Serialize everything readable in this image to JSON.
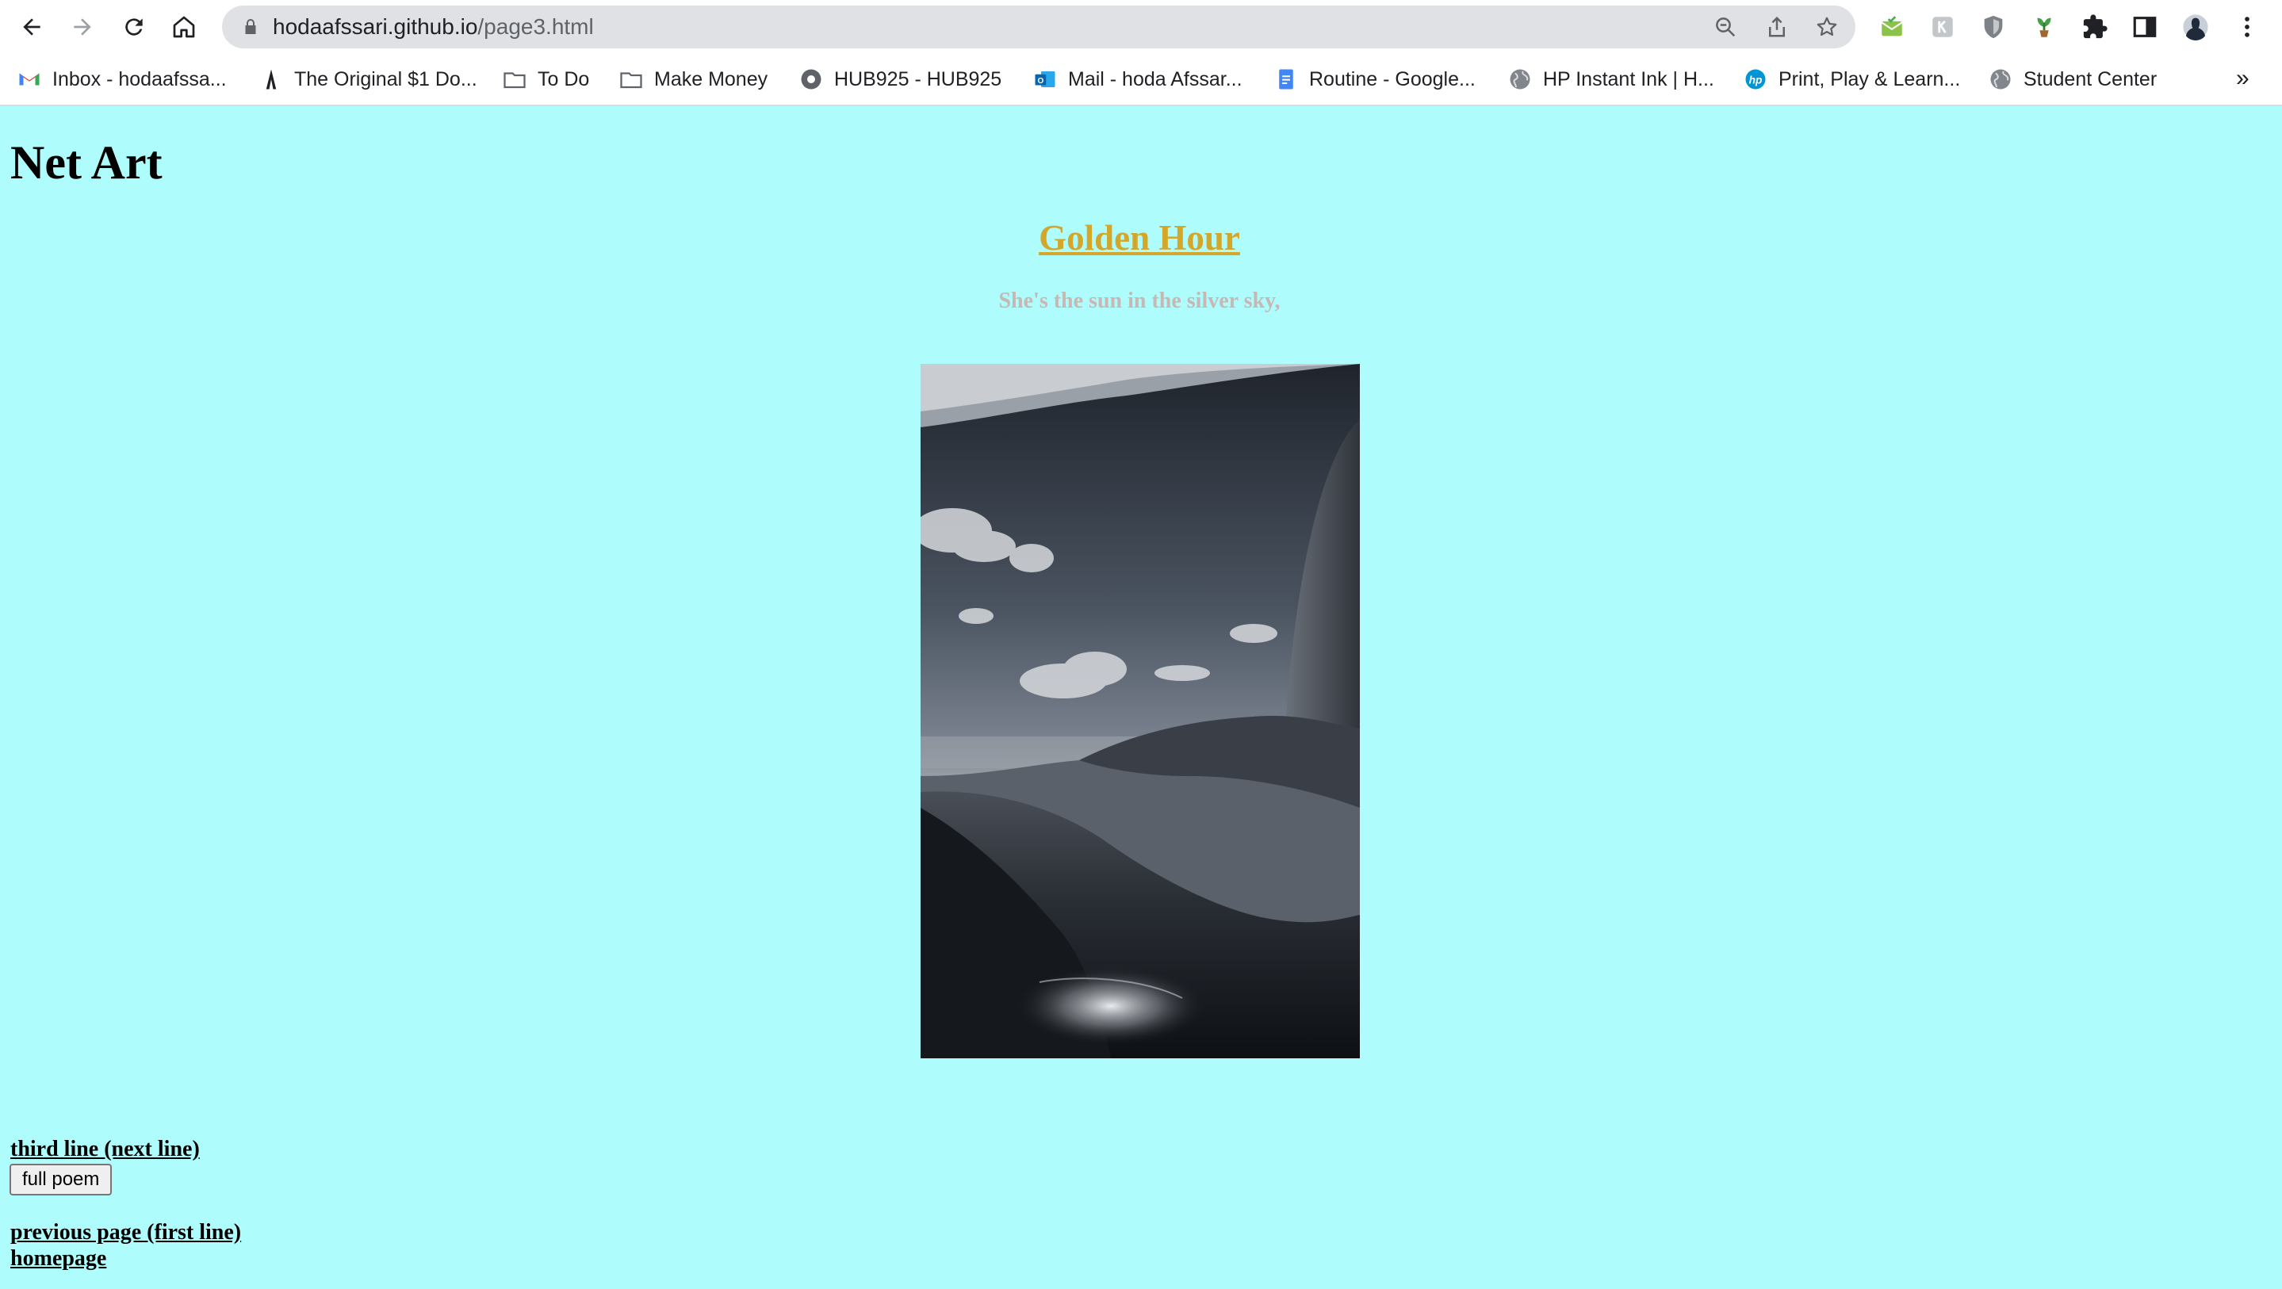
{
  "browser": {
    "url_host": "hodaafssari.github.io",
    "url_path": "/page3.html",
    "bookmarks": [
      {
        "label": "Inbox - hodaafssa...",
        "icon": "gmail-icon"
      },
      {
        "label": "The Original $1 Do...",
        "icon": "bookmark-site-icon"
      },
      {
        "label": "To Do",
        "icon": "folder-icon"
      },
      {
        "label": "Make Money",
        "icon": "folder-icon"
      },
      {
        "label": "HUB925 - HUB925",
        "icon": "hub-icon"
      },
      {
        "label": "Mail - hoda Afssar...",
        "icon": "outlook-icon"
      },
      {
        "label": "Routine - Google...",
        "icon": "google-docs-icon"
      },
      {
        "label": "HP Instant Ink | H...",
        "icon": "globe-icon"
      },
      {
        "label": "Print, Play & Learn...",
        "icon": "hp-icon"
      },
      {
        "label": "Student Center",
        "icon": "globe-icon"
      }
    ],
    "bookmarks_overflow": "»"
  },
  "page": {
    "heading": "Net Art",
    "poem_title": "Golden Hour",
    "poem_line": "She's the sun in the silver sky,",
    "next_link": "third line (next line)",
    "full_poem_button": "full poem",
    "previous_link": "previous page (first line)",
    "home_link": "homepage"
  },
  "colors": {
    "page_background": "#aefcfc",
    "title": "#d4a62a",
    "poem_line": "#c6b8b4"
  }
}
